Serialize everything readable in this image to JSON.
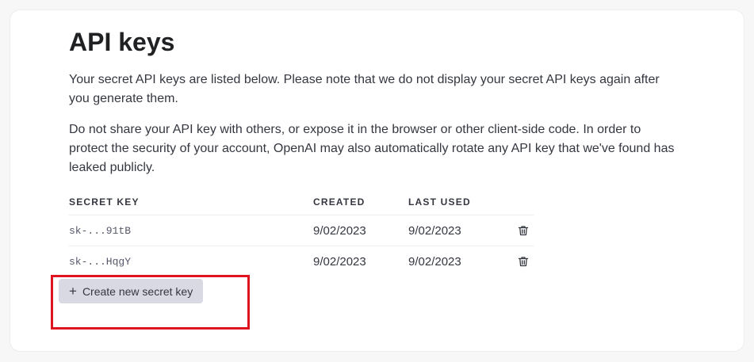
{
  "page": {
    "title": "API keys",
    "paragraph1": "Your secret API keys are listed below. Please note that we do not display your secret API keys again after you generate them.",
    "paragraph2": "Do not share your API key with others, or expose it in the browser or other client-side code. In order to protect the security of your account, OpenAI may also automatically rotate any API key that we've found has leaked publicly."
  },
  "table": {
    "headers": {
      "secret_key": "SECRET KEY",
      "created": "CREATED",
      "last_used": "LAST USED"
    },
    "rows": [
      {
        "key": "sk-...91tB",
        "created": "9/02/2023",
        "last_used": "9/02/2023",
        "delete_icon": "trash-icon"
      },
      {
        "key": "sk-...HqgY",
        "created": "9/02/2023",
        "last_used": "9/02/2023",
        "delete_icon": "trash-icon"
      }
    ]
  },
  "actions": {
    "create_icon": "plus-icon",
    "create_label": "Create new secret key"
  },
  "colors": {
    "highlight": "#e0141e",
    "button_bg": "#d9d9e3"
  }
}
